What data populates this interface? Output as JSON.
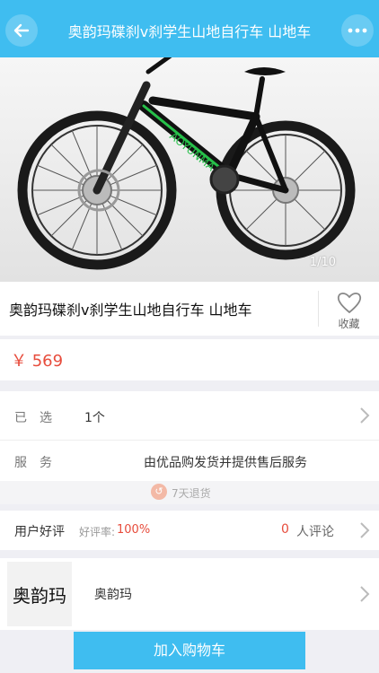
{
  "header": {
    "title": "奥韵玛碟刹v刹学生山地自行车 山地车",
    "back_icon": "arrow-left-icon",
    "more_icon": "more-dots-icon",
    "accent": "#3fbdf0"
  },
  "gallery": {
    "pager": "1/10",
    "frame_brand": "AOYUNMA"
  },
  "product": {
    "name": "奥韵玛碟刹v刹学生山地自行车 山地车",
    "favorite_label": "收藏",
    "price": "￥ 569",
    "price_color": "#e74c3c"
  },
  "selection": {
    "label": "已选",
    "value": "1个"
  },
  "service": {
    "label": "服务",
    "value": "由优品购发货并提供售后服务",
    "returns": "7天退货"
  },
  "reviews": {
    "title": "用户好评",
    "rate_label": "好评率:",
    "rate_value": "100%",
    "count": "0",
    "count_suffix": "人评论"
  },
  "brand": {
    "logo_text": "奥韵玛",
    "name": "奥韵玛"
  },
  "actions": {
    "add_to_cart": "加入购物车"
  }
}
